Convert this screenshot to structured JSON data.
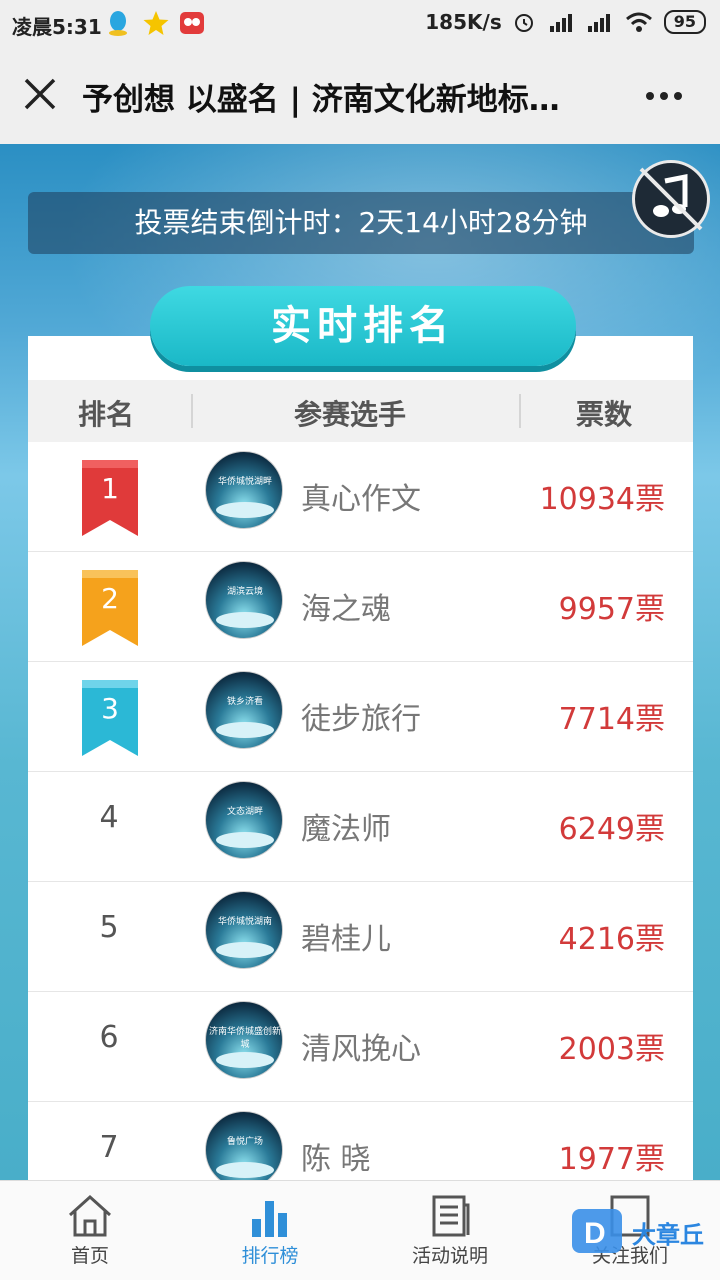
{
  "status_bar": {
    "time": "凌晨5:31",
    "network_speed": "185K/s",
    "battery": "95"
  },
  "nav": {
    "title": "予创想 以盛名 | 济南文化新地标…"
  },
  "countdown": {
    "text": "投票结束倒计时：2天14小时28分钟"
  },
  "ranking": {
    "title": "实时排名",
    "headers": {
      "rank": "排名",
      "contestant": "参赛选手",
      "votes": "票数"
    },
    "rows": [
      {
        "rank": "1",
        "name": "真心作文",
        "votes": "10934票",
        "avatar_caption": "华侨城悦湖畔"
      },
      {
        "rank": "2",
        "name": "海之魂",
        "votes": "9957票",
        "avatar_caption": "湖滨云境"
      },
      {
        "rank": "3",
        "name": "徒步旅行",
        "votes": "7714票",
        "avatar_caption": "铁乡济看"
      },
      {
        "rank": "4",
        "name": "魔法师",
        "votes": "6249票",
        "avatar_caption": "文态湖畔"
      },
      {
        "rank": "5",
        "name": "碧桂儿",
        "votes": "4216票",
        "avatar_caption": "华侨城悦湖南"
      },
      {
        "rank": "6",
        "name": "清风挽心",
        "votes": "2003票",
        "avatar_caption": "济南华侨城盛创新城"
      },
      {
        "rank": "7",
        "name": "陈 晓",
        "votes": "1977票",
        "avatar_caption": "鲁悦广场"
      }
    ]
  },
  "tabs": [
    {
      "label": "首页",
      "icon": "home-icon"
    },
    {
      "label": "排行榜",
      "icon": "bar-chart-icon"
    },
    {
      "label": "活动说明",
      "icon": "document-icon"
    },
    {
      "label": "关注我们",
      "icon": "follow-icon"
    }
  ],
  "watermark": {
    "text": "大章丘"
  },
  "colors": {
    "accent_blue": "#2f8fd8",
    "vote_red": "#d23a3a",
    "rank1_red": "#e03a3a",
    "rank2_orange": "#f5a21c",
    "rank3_cyan": "#2bb8d6",
    "title_teal": "#1ab8c7"
  }
}
